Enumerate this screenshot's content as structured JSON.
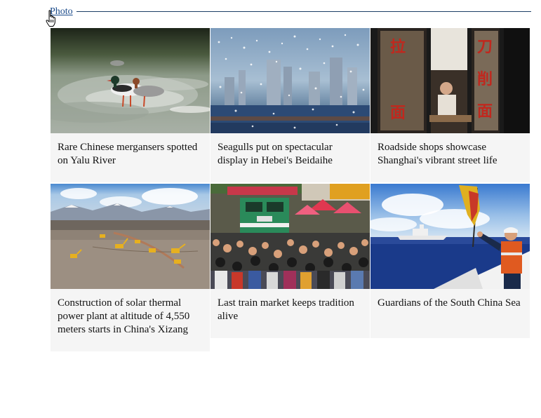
{
  "section": {
    "title": "Photo"
  },
  "cards": [
    {
      "caption": "Rare Chinese mergansers spotted on Yalu River",
      "image_icon": "mergansers-photo"
    },
    {
      "caption": "Seagulls put on spectacular display in Hebei's Beidaihe",
      "image_icon": "seagulls-photo"
    },
    {
      "caption": "Roadside shops showcase Shanghai's vibrant street life",
      "image_icon": "noodle-shop-photo",
      "sign_left": "拉",
      "sign_left_2": "面",
      "sign_right": "刀",
      "sign_right_2": "削",
      "sign_right_3": "面"
    },
    {
      "caption": "Construction of solar thermal power plant at altitude of 4,550 meters starts in China's Xizang",
      "image_icon": "solar-construction-photo"
    },
    {
      "caption": "Last train market keeps tradition alive",
      "image_icon": "train-market-photo"
    },
    {
      "caption": "Guardians of the South China Sea",
      "image_icon": "coast-guard-photo"
    }
  ]
}
